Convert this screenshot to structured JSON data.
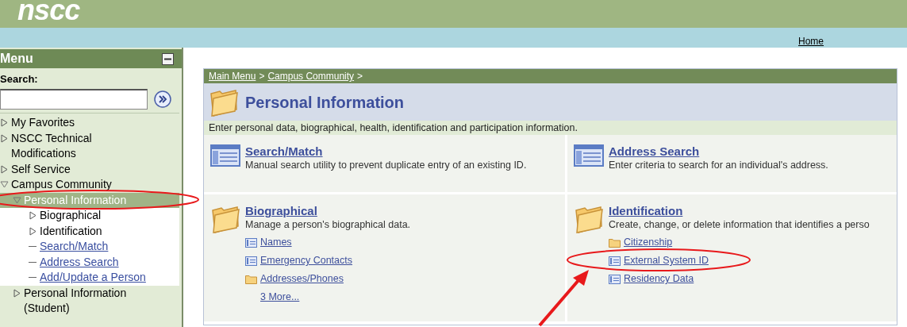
{
  "header": {
    "logo": "nscc",
    "home_link": "Home"
  },
  "sidebar": {
    "title": "Menu",
    "search_label": "Search:",
    "items": [
      {
        "label": "My Favorites",
        "kind": "folder",
        "expanded": false,
        "selected": false
      },
      {
        "label": "NSCC Technical Modifications",
        "kind": "folder",
        "expanded": false,
        "selected": false
      },
      {
        "label": "Self Service",
        "kind": "folder",
        "expanded": false,
        "selected": false
      },
      {
        "label": "Campus Community",
        "kind": "folder",
        "expanded": true,
        "selected": false,
        "children": [
          {
            "label": "Personal Information",
            "kind": "folder",
            "expanded": true,
            "selected": true,
            "children": [
              {
                "label": "Biographical",
                "kind": "folder",
                "expanded": false,
                "selected": false
              },
              {
                "label": "Identification",
                "kind": "folder",
                "expanded": false,
                "selected": false
              },
              {
                "label": "Search/Match",
                "kind": "link",
                "selected": false
              },
              {
                "label": "Address Search",
                "kind": "link",
                "selected": false
              },
              {
                "label": "Add/Update a Person",
                "kind": "link",
                "selected": false
              }
            ]
          },
          {
            "label": "Personal Information (Student)",
            "kind": "folder",
            "expanded": false,
            "selected": false
          }
        ]
      }
    ]
  },
  "content": {
    "breadcrumb": [
      {
        "label": "Main Menu",
        "kind": "link"
      },
      {
        "label": ">",
        "kind": "separator"
      },
      {
        "label": "Campus Community",
        "kind": "link"
      },
      {
        "label": ">",
        "kind": "separator"
      }
    ],
    "title": "Personal Information",
    "description": "Enter personal data, biographical, health, identification and participation information.",
    "cards": [
      {
        "title": "Search/Match",
        "kind": "page",
        "description": "Manual search utility to prevent duplicate entry of an existing ID."
      },
      {
        "title": "Address Search",
        "kind": "page",
        "description": "Enter criteria to search for an individual's address."
      },
      {
        "title": "Biographical",
        "kind": "folder",
        "description": "Manage a person's biographical data.",
        "links": [
          {
            "label": "Names",
            "kind": "page"
          },
          {
            "label": "Emergency Contacts",
            "kind": "page"
          },
          {
            "label": "Addresses/Phones",
            "kind": "folder"
          },
          {
            "label": "3 More...",
            "kind": "more"
          }
        ]
      },
      {
        "title": "Identification",
        "kind": "folder",
        "description": "Create, change, or delete information that identifies a perso",
        "links": [
          {
            "label": "Citizenship",
            "kind": "folder"
          },
          {
            "label": "External System ID",
            "kind": "page"
          },
          {
            "label": "Residency Data",
            "kind": "page"
          }
        ]
      }
    ]
  }
}
